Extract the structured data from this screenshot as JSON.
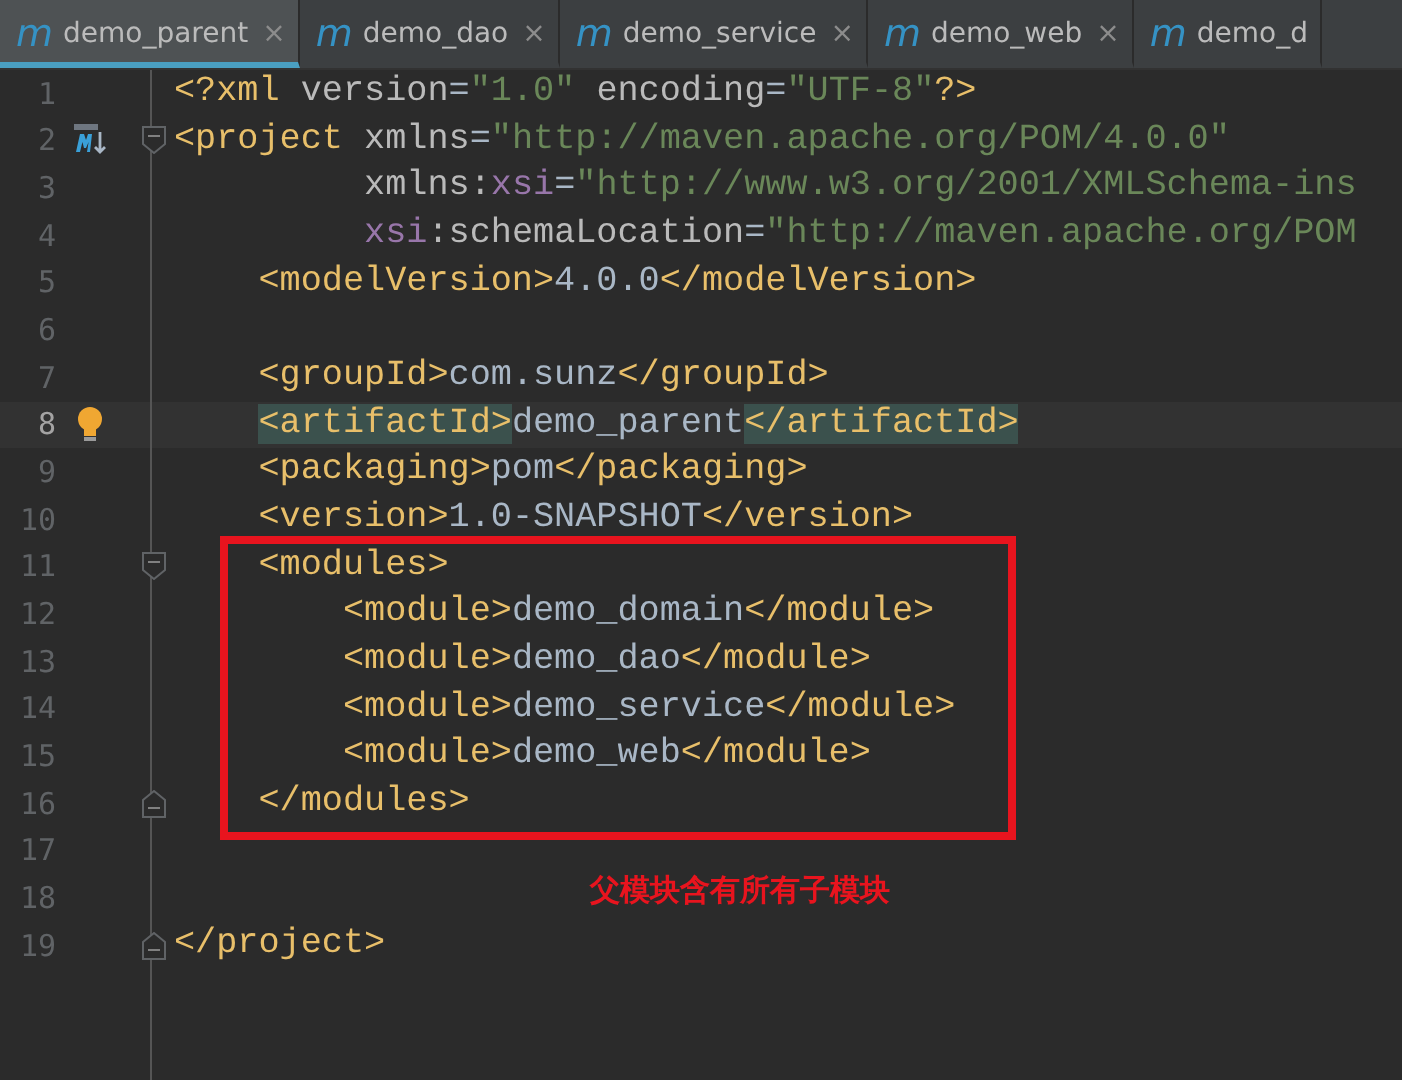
{
  "tabs": [
    {
      "label": "demo_parent",
      "icon": "m",
      "close": "×",
      "selected": true
    },
    {
      "label": "demo_dao",
      "icon": "m",
      "close": "×",
      "selected": false
    },
    {
      "label": "demo_service",
      "icon": "m",
      "close": "×",
      "selected": false
    },
    {
      "label": "demo_web",
      "icon": "m",
      "close": "×",
      "selected": false
    },
    {
      "label": "demo_d",
      "icon": "m",
      "selected": false
    }
  ],
  "editor": {
    "lines": [
      {
        "number": "1",
        "current": false,
        "tokens": [
          {
            "kind": "tag",
            "text": "<?xml"
          },
          {
            "kind": "attr",
            "text": " version"
          },
          {
            "kind": "text",
            "text": "="
          },
          {
            "kind": "string",
            "text": "\"1.0\""
          },
          {
            "kind": "attr",
            "text": " encoding"
          },
          {
            "kind": "text",
            "text": "="
          },
          {
            "kind": "string",
            "text": "\"UTF-8\""
          },
          {
            "kind": "tag",
            "text": "?>"
          }
        ]
      },
      {
        "number": "2",
        "current": false,
        "maven_icon": true,
        "fold_start": true,
        "tokens": [
          {
            "kind": "tag",
            "text": "<project"
          },
          {
            "kind": "attr",
            "text": " xmlns"
          },
          {
            "kind": "text",
            "text": "="
          },
          {
            "kind": "string",
            "text": "\"http://maven.apache.org/POM/4.0.0\""
          }
        ]
      },
      {
        "number": "3",
        "current": false,
        "tokens": [
          {
            "kind": "attr",
            "text": "         xmlns:"
          },
          {
            "kind": "ns",
            "text": "xsi"
          },
          {
            "kind": "text",
            "text": "="
          },
          {
            "kind": "string",
            "text": "\"http://www.w3.org/2001/XMLSchema-ins"
          }
        ]
      },
      {
        "number": "4",
        "current": false,
        "tokens": [
          {
            "kind": "ns",
            "text": "         xsi"
          },
          {
            "kind": "attr",
            "text": ":schemaLocation"
          },
          {
            "kind": "text",
            "text": "="
          },
          {
            "kind": "string",
            "text": "\"http://maven.apache.org/POM"
          }
        ]
      },
      {
        "number": "5",
        "current": false,
        "tokens": [
          {
            "kind": "tag",
            "text": "    <modelVersion>"
          },
          {
            "kind": "text",
            "text": "4.0.0"
          },
          {
            "kind": "tag",
            "text": "</modelVersion>"
          }
        ]
      },
      {
        "number": "6",
        "current": false
      },
      {
        "number": "7",
        "current": false,
        "tokens": [
          {
            "kind": "tag",
            "text": "    <groupId>"
          },
          {
            "kind": "text",
            "text": "com.sunz"
          },
          {
            "kind": "tag",
            "text": "</groupId>"
          }
        ]
      },
      {
        "number": "8",
        "current": true,
        "bulb_icon": true,
        "tokens": [
          {
            "kind": "tag",
            "text": "    <artifactId>",
            "matched": true
          },
          {
            "kind": "text",
            "text": "demo_parent"
          },
          {
            "kind": "tag",
            "text": "</artifactId>",
            "matched": true
          }
        ]
      },
      {
        "number": "9",
        "current": false,
        "tokens": [
          {
            "kind": "tag",
            "text": "    <packaging>"
          },
          {
            "kind": "text",
            "text": "pom"
          },
          {
            "kind": "tag",
            "text": "</packaging>"
          }
        ]
      },
      {
        "number": "10",
        "current": false,
        "tokens": [
          {
            "kind": "tag",
            "text": "    <version>"
          },
          {
            "kind": "text",
            "text": "1.0-SNAPSHOT"
          },
          {
            "kind": "tag",
            "text": "</version>"
          }
        ]
      },
      {
        "number": "11",
        "current": false,
        "boxed": true,
        "fold_start": true,
        "tokens": [
          {
            "kind": "tag",
            "text": "    <modules>"
          }
        ]
      },
      {
        "number": "12",
        "current": false,
        "boxed": true,
        "tokens": [
          {
            "kind": "tag",
            "text": "        <module>"
          },
          {
            "kind": "text",
            "text": "demo_domain"
          },
          {
            "kind": "tag",
            "text": "</module>"
          }
        ]
      },
      {
        "number": "13",
        "current": false,
        "boxed": true,
        "tokens": [
          {
            "kind": "tag",
            "text": "        <module>"
          },
          {
            "kind": "text",
            "text": "demo_dao"
          },
          {
            "kind": "tag",
            "text": "</module>"
          }
        ]
      },
      {
        "number": "14",
        "current": false,
        "boxed": true,
        "tokens": [
          {
            "kind": "tag",
            "text": "        <module>"
          },
          {
            "kind": "text",
            "text": "demo_service"
          },
          {
            "kind": "tag",
            "text": "</module>"
          }
        ]
      },
      {
        "number": "15",
        "current": false,
        "boxed": true,
        "tokens": [
          {
            "kind": "tag",
            "text": "        <module>"
          },
          {
            "kind": "text",
            "text": "demo_web"
          },
          {
            "kind": "tag",
            "text": "</module>"
          }
        ]
      },
      {
        "number": "16",
        "current": false,
        "boxed": true,
        "fold_end": true,
        "tokens": [
          {
            "kind": "tag",
            "text": "    </modules>"
          }
        ]
      },
      {
        "number": "17",
        "current": false
      },
      {
        "number": "18",
        "current": false
      },
      {
        "number": "19",
        "current": false,
        "fold_end": true,
        "tokens": [
          {
            "kind": "tag",
            "text": "</project>"
          }
        ]
      }
    ],
    "annotation": "父模块含有所有子模块"
  }
}
